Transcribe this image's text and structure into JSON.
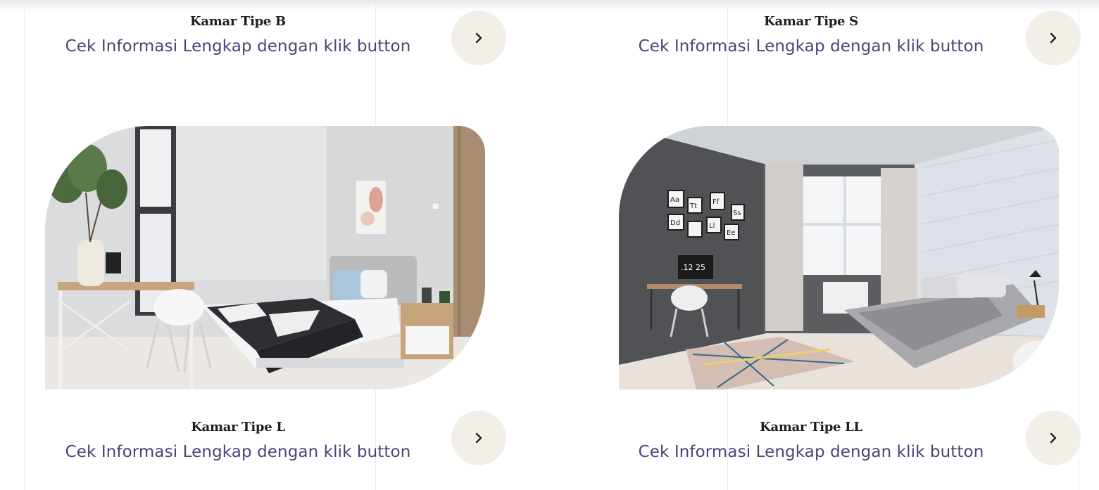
{
  "cards": [
    {
      "title": "Kamar Tipe B",
      "subtitle": "Cek Informasi Lengkap dengan klik button"
    },
    {
      "title": "Kamar Tipe S",
      "subtitle": "Cek Informasi Lengkap dengan klik button"
    },
    {
      "title": "Kamar Tipe L",
      "subtitle": "Cek Informasi Lengkap dengan klik button"
    },
    {
      "title": "Kamar Tipe LL",
      "subtitle": "Cek Informasi Lengkap dengan klik button"
    }
  ],
  "icons": {
    "arrow": "chevron-right-icon"
  },
  "photo_labels": {
    "clock": ".12 25",
    "letters": [
      "Aa",
      "Tt",
      "Ff",
      "Ss",
      "Dd",
      "Ll",
      "Ee"
    ]
  },
  "colors": {
    "title": "#1f1f1f",
    "subtitle": "#4a4478",
    "button_bg": "#f2efe9"
  }
}
